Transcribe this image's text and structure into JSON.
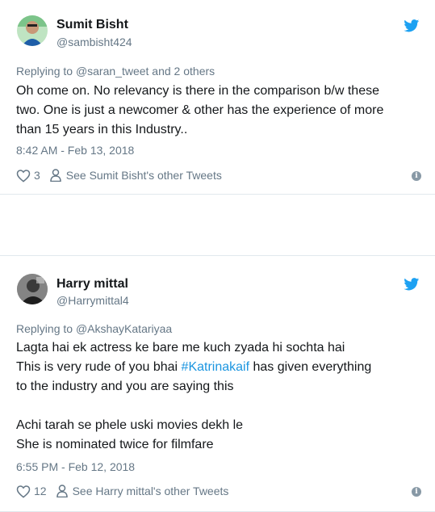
{
  "tweets": [
    {
      "name": "Sumit Bisht",
      "handle": "@sambisht424",
      "reply_prefix": "Replying to ",
      "reply_targets": "@saran_tweet and 2 others",
      "body_lines": [
        "Oh come on. No relevancy is there in the comparison b/w these",
        "two. One is just a newcomer & other has the experience of more",
        "than 15 years in this Industry.."
      ],
      "timestamp": "8:42 AM - Feb 13, 2018",
      "likes": "3",
      "other_tweets_link": "See Sumit Bisht's other Tweets"
    },
    {
      "name": "Harry mittal",
      "handle": "@Harrymittal4",
      "reply_prefix": "Replying to ",
      "reply_targets": "@AkshayKatariyaa",
      "body_lines": [
        "Lagta hai ek actress ke bare me kuch zyada hi sochta hai",
        "This is very rude of you bhai ",
        "#Katrinakaif",
        " has given everything",
        "to the industry and you are saying this",
        "Achi tarah se phele uski movies dekh le",
        "She is nominated twice for filmfare"
      ],
      "timestamp": "6:55 PM - Feb 12, 2018",
      "likes": "12",
      "other_tweets_link": "See Harry mittal's other Tweets"
    }
  ],
  "colors": {
    "twitter_blue": "#1da1f2",
    "hashtag": "#1b95e0",
    "secondary_text": "#657786",
    "border": "#e1e8ed"
  },
  "icons": [
    "twitter-bird-icon",
    "heart-icon",
    "user-icon",
    "info-icon"
  ]
}
